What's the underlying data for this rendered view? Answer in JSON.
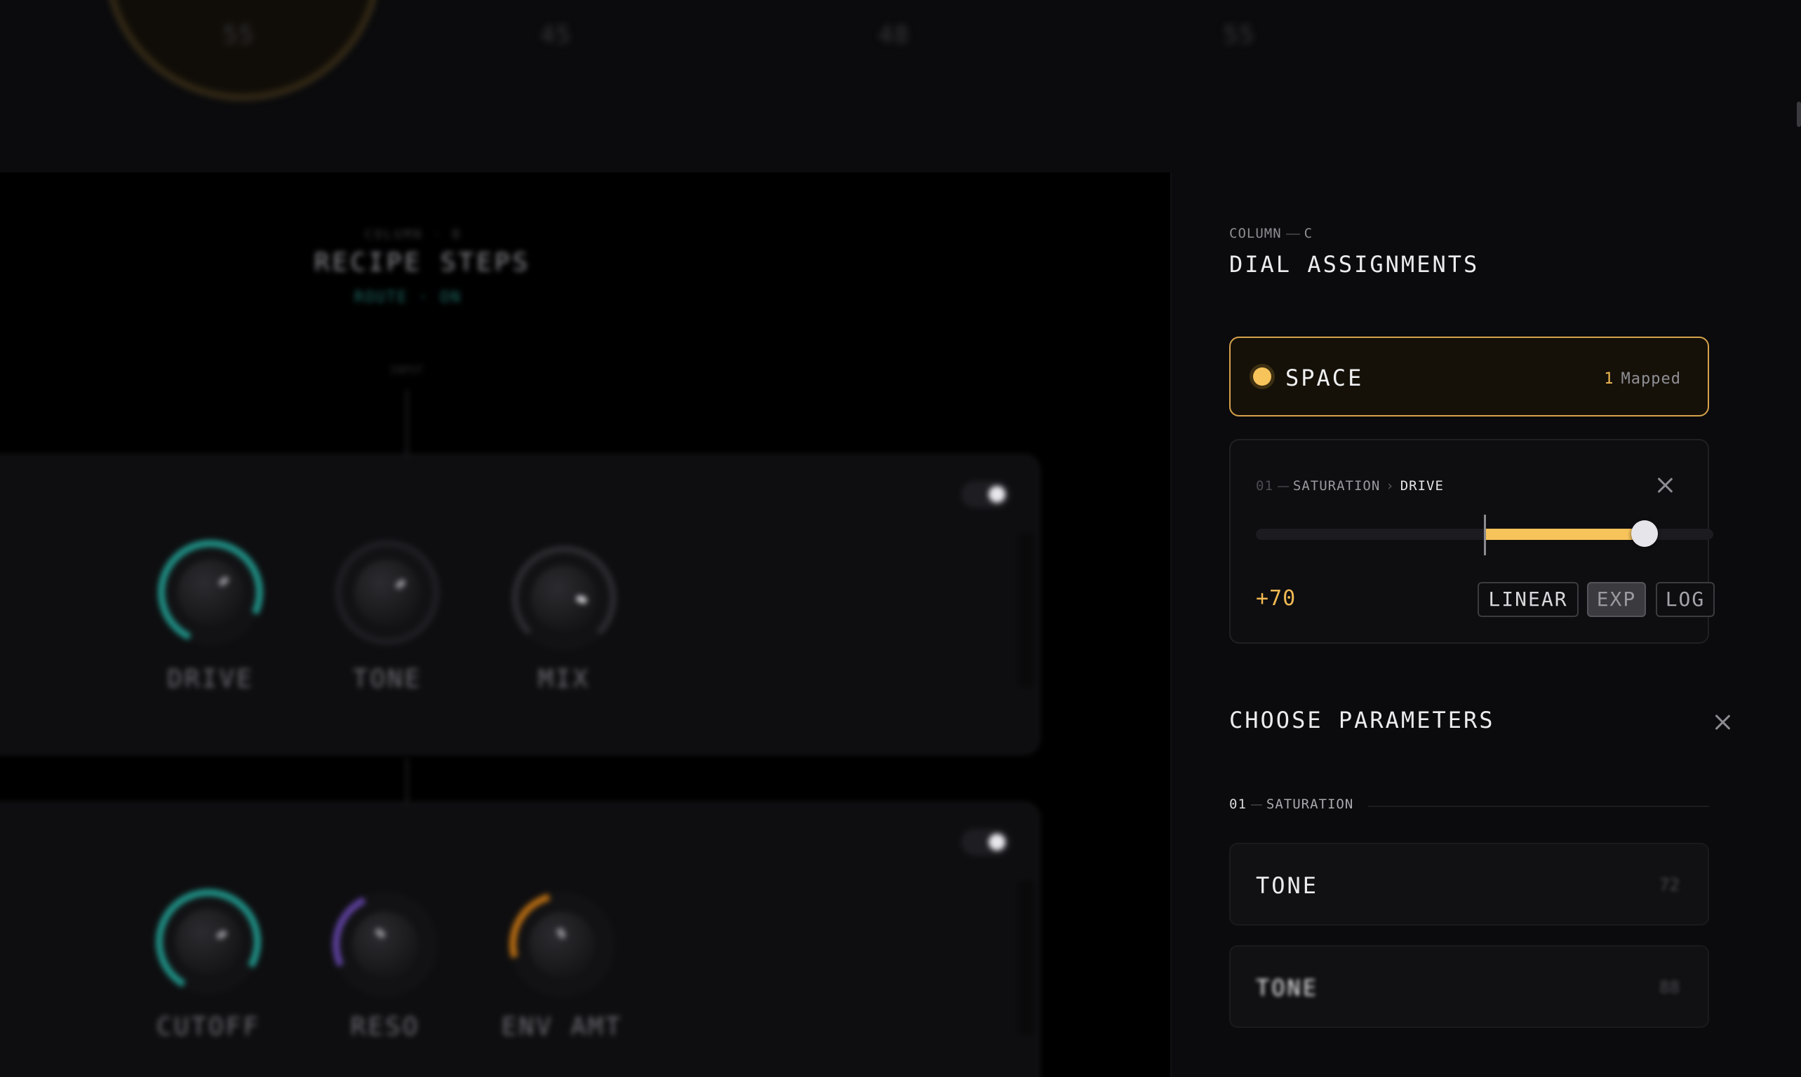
{
  "top_bar": {
    "values": [
      "55",
      "45",
      "48",
      "55"
    ]
  },
  "recipe": {
    "column_label": "COLUMN · B",
    "title": "RECIPE STEPS",
    "status": "ROUTE · ON",
    "small_label": "INPUT",
    "panels": [
      {
        "enabled": true,
        "knobs": [
          {
            "label": "DRIVE",
            "color": "#1f8f85",
            "level": 0.72
          },
          {
            "label": "TONE",
            "color": "#2a2a2e",
            "level": 0.5
          },
          {
            "label": "MIX",
            "color": "#2a2a2e",
            "level": 0.6
          }
        ]
      },
      {
        "enabled": true,
        "knobs": [
          {
            "label": "CUTOFF",
            "color": "#1f8f85",
            "level": 0.7
          },
          {
            "label": "RESO",
            "color": "#5b3f9a",
            "level": 0.3
          },
          {
            "label": "ENV AMT",
            "color": "#b36a12",
            "level": 0.35
          }
        ]
      }
    ]
  },
  "dial_assignments": {
    "column_label": "COLUMN",
    "column_letter": "C",
    "title": "DIAL ASSIGNMENTS",
    "dial": {
      "name": "SPACE",
      "mapped_count": "1",
      "mapped_label": "Mapped",
      "color": "#f7c35b"
    },
    "mapping": {
      "index": "01",
      "module": "SATURATION",
      "parameter": "DRIVE",
      "value_text": "+70",
      "value": 70,
      "range": [
        -100,
        100
      ],
      "curves": [
        "LINEAR",
        "EXP",
        "LOG"
      ],
      "selected_curve": "EXP"
    }
  },
  "choose_parameters": {
    "title": "CHOOSE PARAMETERS",
    "group": {
      "index": "01",
      "name": "SATURATION"
    },
    "params": [
      {
        "name": "TONE",
        "value": "72"
      },
      {
        "name": "TONE",
        "value": "88"
      }
    ]
  },
  "colors": {
    "accent": "#f7c35b",
    "teal": "#1f8f85",
    "background": "#0b0b0d"
  }
}
